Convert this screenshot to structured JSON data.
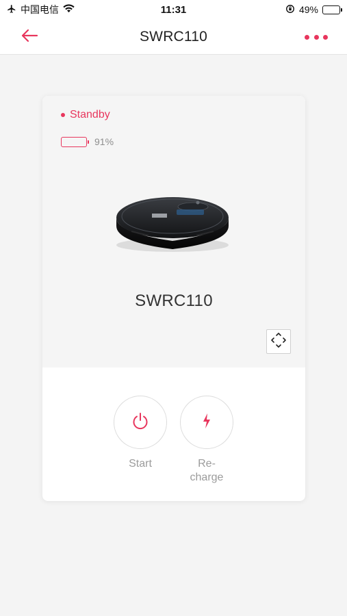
{
  "status_bar": {
    "carrier": "中国电信",
    "time": "11:31",
    "battery_percent": "49%",
    "battery_level": 0.49
  },
  "nav": {
    "title": "SWRC110"
  },
  "device": {
    "status": "Standby",
    "battery_text": "91%",
    "battery_level": 0.91,
    "name": "SWRC110"
  },
  "actions": {
    "start_label": "Start",
    "recharge_line1": "Re-",
    "recharge_line2": "charge"
  },
  "colors": {
    "accent": "#e8365d",
    "background": "#f4f4f4"
  },
  "icons": [
    "airplane-icon",
    "wifi-icon",
    "rotation-lock-icon",
    "battery-icon",
    "back-arrow-icon",
    "more-dots-icon",
    "power-icon",
    "lightning-icon",
    "expand-icon"
  ]
}
